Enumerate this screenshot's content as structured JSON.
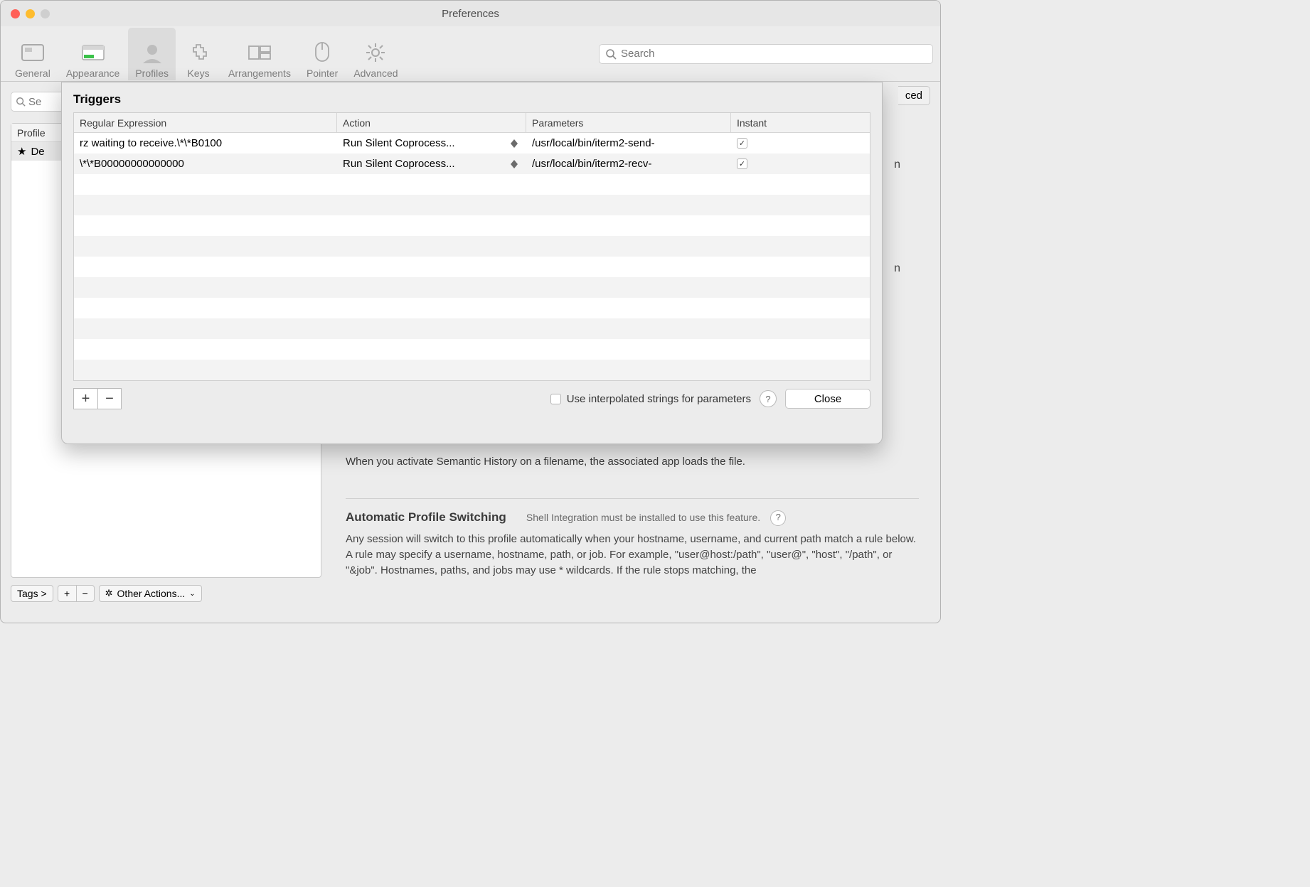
{
  "window": {
    "title": "Preferences"
  },
  "toolbar": {
    "items": [
      "General",
      "Appearance",
      "Profiles",
      "Keys",
      "Arrangements",
      "Pointer",
      "Advanced"
    ],
    "active": "Profiles",
    "search_placeholder": "Search"
  },
  "sidebar": {
    "search_placeholder": "Se",
    "header": "Profile",
    "selected": "De",
    "tags_label": "Tags >",
    "other_actions": "Other Actions..."
  },
  "bg_tab_right": "ced",
  "bg_letter_1": "n",
  "bg_letter_2": "n",
  "right": {
    "semantic_text": "When you activate Semantic History on a filename, the associated app loads the file.",
    "aps_title": "Automatic Profile Switching",
    "aps_note": "Shell Integration must be installed to use this feature.",
    "aps_body": "Any session will switch to this profile automatically when your hostname, username, and current path match a rule below. A rule may specify a username, hostname, path, or job. For example, \"user@host:/path\", \"user@\", \"host\", \"/path\", or \"&job\". Hostnames, paths, and jobs may use * wildcards. If the rule stops matching, the"
  },
  "sheet": {
    "title": "Triggers",
    "columns": [
      "Regular Expression",
      "Action",
      "Parameters",
      "Instant"
    ],
    "rows": [
      {
        "re": "rz waiting to receive.\\*\\*B0100",
        "action": "Run Silent Coprocess...",
        "params": "/usr/local/bin/iterm2-send-",
        "instant": true
      },
      {
        "re": "\\*\\*B00000000000000",
        "action": "Run Silent Coprocess...",
        "params": "/usr/local/bin/iterm2-recv-",
        "instant": true
      }
    ],
    "interp_label": "Use interpolated strings for parameters",
    "close_label": "Close"
  }
}
